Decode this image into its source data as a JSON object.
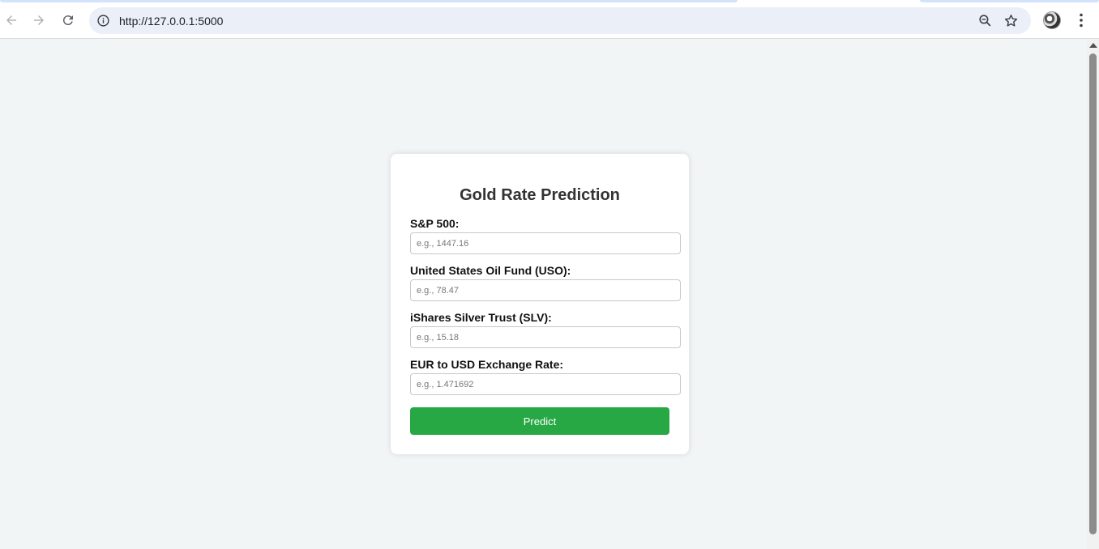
{
  "browser": {
    "url": "http://127.0.0.1:5000"
  },
  "form": {
    "title": "Gold Rate Prediction",
    "fields": [
      {
        "label": "S&P 500:",
        "placeholder": "e.g., 1447.16",
        "value": ""
      },
      {
        "label": "United States Oil Fund (USO):",
        "placeholder": "e.g., 78.47",
        "value": ""
      },
      {
        "label": "iShares Silver Trust (SLV):",
        "placeholder": "e.g., 15.18",
        "value": ""
      },
      {
        "label": "EUR to USD Exchange Rate:",
        "placeholder": "e.g., 1.471692",
        "value": ""
      }
    ],
    "submit_label": "Predict"
  },
  "colors": {
    "page_background": "#f2f5f6",
    "button": "#28a745",
    "omnibox": "#eaeff8"
  },
  "icons": [
    "back-arrow-icon",
    "forward-arrow-icon",
    "reload-icon",
    "site-info-icon",
    "zoom-icon",
    "bookmark-star-icon",
    "profile-avatar",
    "kebab-menu-icon"
  ]
}
